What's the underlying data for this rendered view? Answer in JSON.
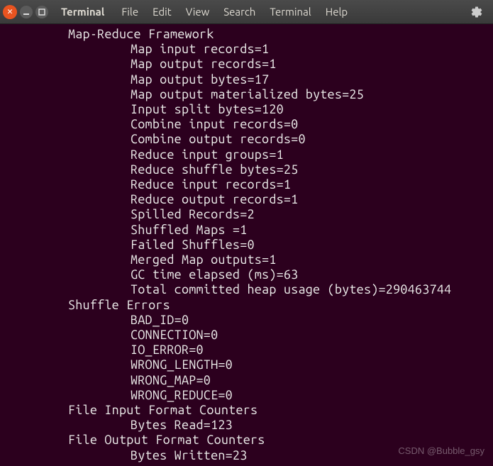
{
  "menubar": {
    "app_title": "Terminal",
    "items": [
      "File",
      "Edit",
      "View",
      "Search",
      "Terminal",
      "Help"
    ]
  },
  "terminal": {
    "sections": [
      {
        "header": "Map-Reduce Framework",
        "counters": [
          "Map input records=1",
          "Map output records=1",
          "Map output bytes=17",
          "Map output materialized bytes=25",
          "Input split bytes=120",
          "Combine input records=0",
          "Combine output records=0",
          "Reduce input groups=1",
          "Reduce shuffle bytes=25",
          "Reduce input records=1",
          "Reduce output records=1",
          "Spilled Records=2",
          "Shuffled Maps =1",
          "Failed Shuffles=0",
          "Merged Map outputs=1",
          "GC time elapsed (ms)=63",
          "Total committed heap usage (bytes)=290463744"
        ]
      },
      {
        "header": "Shuffle Errors",
        "counters": [
          "BAD_ID=0",
          "CONNECTION=0",
          "IO_ERROR=0",
          "WRONG_LENGTH=0",
          "WRONG_MAP=0",
          "WRONG_REDUCE=0"
        ]
      },
      {
        "header": "File Input Format Counters ",
        "counters": [
          "Bytes Read=123"
        ]
      },
      {
        "header": "File Output Format Counters ",
        "counters": [
          "Bytes Written=23"
        ]
      }
    ]
  },
  "watermark": "CSDN @Bubble_gsy"
}
